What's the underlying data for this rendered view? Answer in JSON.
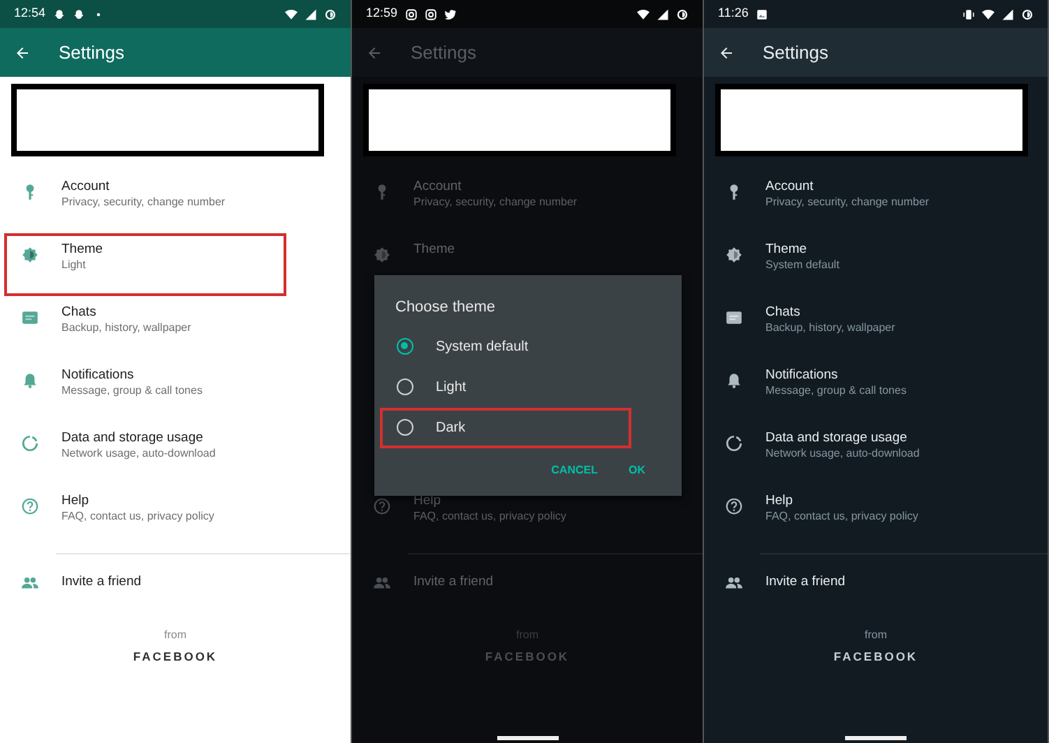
{
  "panels": [
    {
      "kind": "light",
      "status_bar": {
        "time": "12:54",
        "left_icons": [
          {
            "kind": "ghost"
          },
          {
            "kind": "ghost"
          },
          {
            "kind": "dot"
          }
        ],
        "right_icons": [
          {
            "kind": "wifi"
          },
          {
            "kind": "signal"
          },
          {
            "kind": "battery"
          }
        ]
      },
      "app_bar": {
        "title": "Settings"
      },
      "home_bar": false,
      "items": [
        {
          "kind": "key",
          "title": "Account",
          "subtitle": "Privacy, security, change number",
          "highlighted": false
        },
        {
          "kind": "theme",
          "title": "Theme",
          "subtitle": "Light",
          "highlighted": true
        },
        {
          "kind": "chat",
          "title": "Chats",
          "subtitle": "Backup, history, wallpaper",
          "highlighted": false
        },
        {
          "kind": "bell",
          "title": "Notifications",
          "subtitle": "Message, group & call tones",
          "highlighted": false
        },
        {
          "kind": "data",
          "title": "Data and storage usage",
          "subtitle": "Network usage, auto-download",
          "highlighted": false
        },
        {
          "kind": "help",
          "title": "Help",
          "subtitle": "FAQ, contact us, privacy policy",
          "highlighted": false
        }
      ],
      "invite": "Invite a friend",
      "footer": {
        "from": "from",
        "brand": "FACEBOOK"
      }
    },
    {
      "kind": "dimmed",
      "status_bar": {
        "time": "12:59",
        "left_icons": [
          {
            "kind": "camera"
          },
          {
            "kind": "camera"
          },
          {
            "kind": "bird"
          }
        ],
        "right_icons": [
          {
            "kind": "wifi"
          },
          {
            "kind": "signal"
          },
          {
            "kind": "battery"
          }
        ]
      },
      "app_bar": {
        "title": "Settings"
      },
      "home_bar": true,
      "items": [
        {
          "kind": "key",
          "title": "Account",
          "subtitle": "Privacy, security, change number",
          "highlighted": false
        },
        {
          "kind": "theme",
          "title": "Theme",
          "highlighted": false
        },
        {
          "kind": "covered"
        },
        {
          "kind": "covered"
        },
        {
          "kind": "covered"
        },
        {
          "kind": "help",
          "title": "Help",
          "subtitle": "FAQ, contact us, privacy policy",
          "highlighted": false
        }
      ],
      "invite": "Invite a friend",
      "footer": {
        "from": "from",
        "brand": "FACEBOOK"
      },
      "dialog": {
        "title": "Choose theme",
        "options": [
          {
            "label": "System default",
            "selected": true,
            "highlighted": false
          },
          {
            "label": "Light",
            "selected": false,
            "highlighted": false
          },
          {
            "label": "Dark",
            "selected": false,
            "highlighted": true
          }
        ],
        "buttons": [
          "CANCEL",
          "OK"
        ]
      }
    },
    {
      "kind": "dark",
      "status_bar": {
        "time": "11:26",
        "left_icons": [
          {
            "kind": "image"
          }
        ],
        "right_icons": [
          {
            "kind": "vibrate"
          },
          {
            "kind": "wifi"
          },
          {
            "kind": "signal"
          },
          {
            "kind": "battery"
          }
        ]
      },
      "app_bar": {
        "title": "Settings"
      },
      "home_bar": true,
      "items": [
        {
          "kind": "key",
          "title": "Account",
          "subtitle": "Privacy, security, change number",
          "highlighted": false
        },
        {
          "kind": "theme",
          "title": "Theme",
          "subtitle": "System default",
          "highlighted": false
        },
        {
          "kind": "chat",
          "title": "Chats",
          "subtitle": "Backup, history, wallpaper",
          "highlighted": false
        },
        {
          "kind": "bell",
          "title": "Notifications",
          "subtitle": "Message, group & call tones",
          "highlighted": false
        },
        {
          "kind": "data",
          "title": "Data and storage usage",
          "subtitle": "Network usage, auto-download",
          "highlighted": false
        },
        {
          "kind": "help",
          "title": "Help",
          "subtitle": "FAQ, contact us, privacy policy",
          "highlighted": false
        }
      ],
      "invite": "Invite a friend",
      "footer": {
        "from": "from",
        "brand": "FACEBOOK"
      }
    }
  ]
}
